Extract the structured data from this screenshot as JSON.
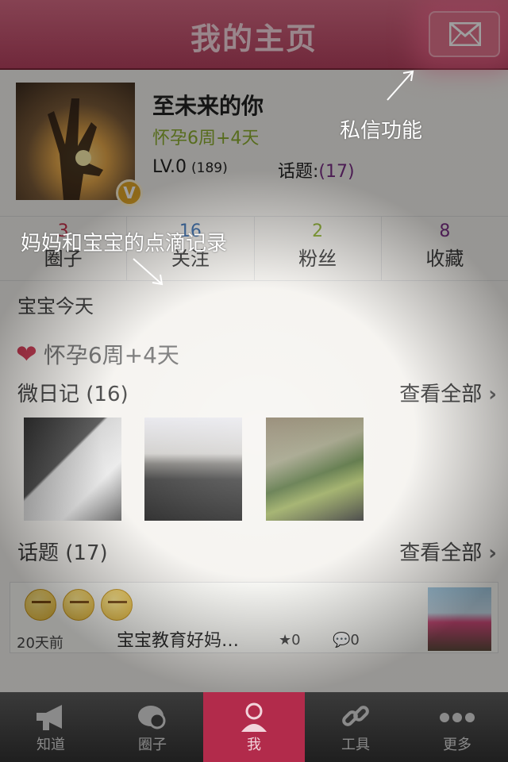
{
  "header": {
    "title": "我的主页"
  },
  "profile": {
    "username": "至未来的你",
    "pregnancy_status": "怀孕6周+4天",
    "level": "LV.0",
    "level_points": "(189)",
    "topics_label": "话题:",
    "topics_count": "(17)",
    "badge": "V"
  },
  "stats": [
    {
      "value": "3",
      "label": "圈子",
      "color": "#c8324c"
    },
    {
      "value": "16",
      "label": "关注",
      "color": "#3a6fb0"
    },
    {
      "value": "2",
      "label": "粉丝",
      "color": "#8caf2e"
    },
    {
      "value": "8",
      "label": "收藏",
      "color": "#7b2e87"
    }
  ],
  "today": {
    "section_title": "宝宝今天",
    "pregnancy_line": "怀孕6周+4天"
  },
  "diary": {
    "title": "微日记 (16)",
    "view_all": "查看全部"
  },
  "topics": {
    "title": "话题 (17)",
    "view_all": "查看全部"
  },
  "topic_card": {
    "time": "20天前",
    "title": "宝宝教育好妈…",
    "stars": "0",
    "comments": "0"
  },
  "annotations": {
    "mail": "私信功能",
    "records": "妈妈和宝宝的点滴记录"
  },
  "tabs": [
    {
      "label": "知道",
      "icon": "megaphone-icon"
    },
    {
      "label": "圈子",
      "icon": "chat-bubble-icon"
    },
    {
      "label": "我",
      "icon": "person-icon",
      "active": true
    },
    {
      "label": "工具",
      "icon": "chain-link-icon"
    },
    {
      "label": "更多",
      "icon": "more-dots-icon"
    }
  ],
  "colors": {
    "header": "#b5415f",
    "accent": "#b22b4b",
    "green": "#8caf2e"
  }
}
